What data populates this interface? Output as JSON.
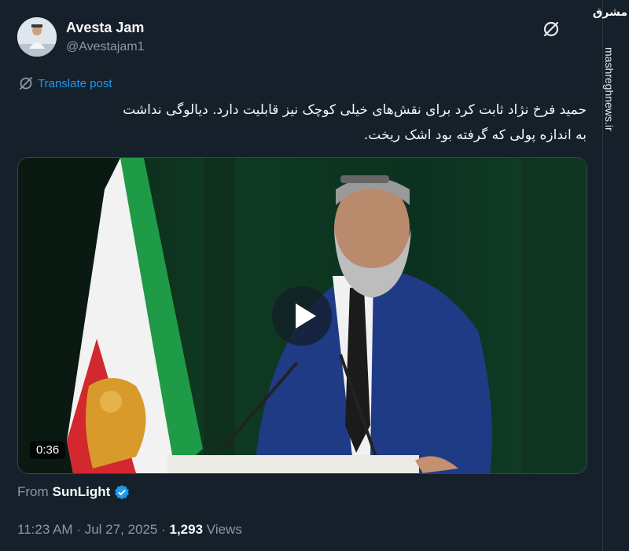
{
  "author": {
    "display_name": "Avesta Jam",
    "handle": "@Avestajam1"
  },
  "translate_label": "Translate post",
  "post_text": {
    "line1": "حمید فرخ نژاد ثابت کرد برای نقش‌های خیلی کوچک نیز قابلیت دارد. دیالوگی نداشت",
    "line2": "به اندازه پولی که گرفته بود اشک ریخت."
  },
  "video": {
    "duration": "0:36"
  },
  "source": {
    "prefix": "From",
    "account": "SunLight"
  },
  "meta": {
    "time": "11:23 AM",
    "separator": "·",
    "date": "Jul 27, 2025",
    "views_count": "1,293",
    "views_label": "Views"
  },
  "watermark": {
    "logo_text": "مشرق",
    "site": "mashreghnews.ir"
  },
  "colors": {
    "background": "#15202b",
    "accent": "#1d9bf0",
    "muted": "#8b98a5",
    "text": "#f7f9f9"
  }
}
